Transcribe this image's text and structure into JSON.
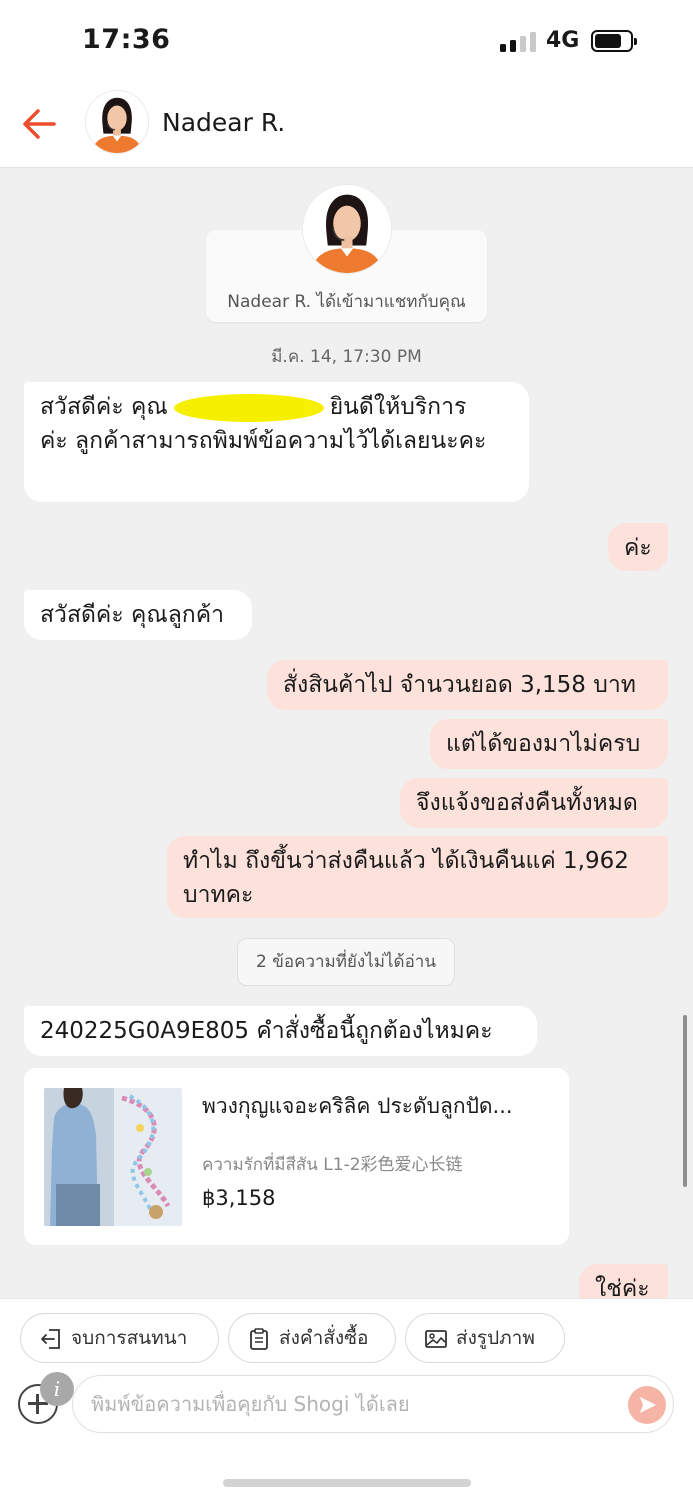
{
  "status_bar": {
    "time": "17:36",
    "network": "4G"
  },
  "header": {
    "contact_name": "Nadear R."
  },
  "chat": {
    "join_notice": "Nadear R. ได้เข้ามาแชทกับคุณ",
    "timestamp": "มี.ค. 14, 17:30 PM",
    "messages": [
      {
        "direction": "in",
        "line1_pre": "สวัสดีค่ะ คุณ",
        "line1_post": "ยินดีให้บริการ",
        "line2": "ค่ะ ลูกค้าสามารถพิมพ์ข้อความไว้ได้เลยนะคะ"
      },
      {
        "direction": "out",
        "text": "ค่ะ"
      },
      {
        "direction": "in",
        "text": "สวัสดีค่ะ คุณลูกค้า"
      },
      {
        "direction": "out",
        "text": "สั่งสินค้าไป จำนวนยอด 3,158 บาท"
      },
      {
        "direction": "out",
        "text": "แต่ได้ของมาไม่ครบ"
      },
      {
        "direction": "out",
        "text": "จึงแจ้งขอส่งคืนทั้งหมด"
      },
      {
        "direction": "out",
        "line1": "ทำไม ถึงขึ้นว่าส่งคืนแล้ว ได้เงินคืนแค่ 1,962",
        "line2": "บาทคะ"
      },
      {
        "direction": "in",
        "text": "240225G0A9E805 คำสั่งซื้อนี้ถูกต้องไหมคะ"
      },
      {
        "direction": "out",
        "text": "ใช่ค่ะ"
      }
    ],
    "unread_notice": "2 ข้อความที่ยังไม่ได้อ่าน",
    "product": {
      "title": "พวงกุญแจอะคริลิค ประดับลูกปัด...",
      "variant": "ความรักที่มีสีสัน L1-2彩色爱心长链",
      "price": "฿3,158"
    }
  },
  "quick_actions": {
    "end_chat": "จบการสนทนา",
    "send_order": "ส่งคำสั่งซื้อ",
    "send_image": "ส่งรูปภาพ"
  },
  "composer": {
    "placeholder": "พิมพ์ข้อความเพื่อคุยกับ Shogi ได้เลย",
    "info_badge": "i"
  },
  "colors": {
    "accent": "#ee4d2d",
    "outgoing_bubble": "#fde2dc",
    "chat_background": "#f0f0f0",
    "redaction": "#f7ef00"
  },
  "icons": {
    "back": "arrow-left-icon",
    "end_chat": "exit-door-icon",
    "send_order": "clipboard-icon",
    "send_image": "image-icon",
    "attach": "plus-circle-icon",
    "send": "send-arrow-icon"
  }
}
